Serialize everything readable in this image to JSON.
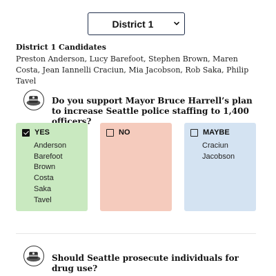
{
  "district_select": {
    "selected": "District 1"
  },
  "candidates": {
    "heading": "District 1 Candidates",
    "list": "Preston Anderson, Lucy Barefoot, Stephen Brown, Maren Costa, Jean Iannelli Craciun, Mia Jacobson, Rob Saka, Philip Tavel"
  },
  "questions": [
    {
      "icon": "candidate-badge-icon",
      "text": "Do you support Mayor Bruce Harrell’s plan to increase Seattle police staffing to 1,400 officers?",
      "answers": {
        "yes": {
          "label": "YES",
          "checked": true,
          "names": [
            "Anderson",
            "Barefoot",
            "Brown",
            "Costa",
            "Saka",
            "Tavel"
          ],
          "color": "#c9e9c0"
        },
        "no": {
          "label": "NO",
          "checked": false,
          "names": [],
          "color": "#f5cbbd"
        },
        "maybe": {
          "label": "MAYBE",
          "checked": false,
          "names": [
            "Craciun",
            "Jacobson"
          ],
          "color": "#d4e3f2"
        }
      }
    },
    {
      "icon": "candidate-badge-icon",
      "text": "Should Seattle prosecute individuals for drug use?"
    }
  ]
}
